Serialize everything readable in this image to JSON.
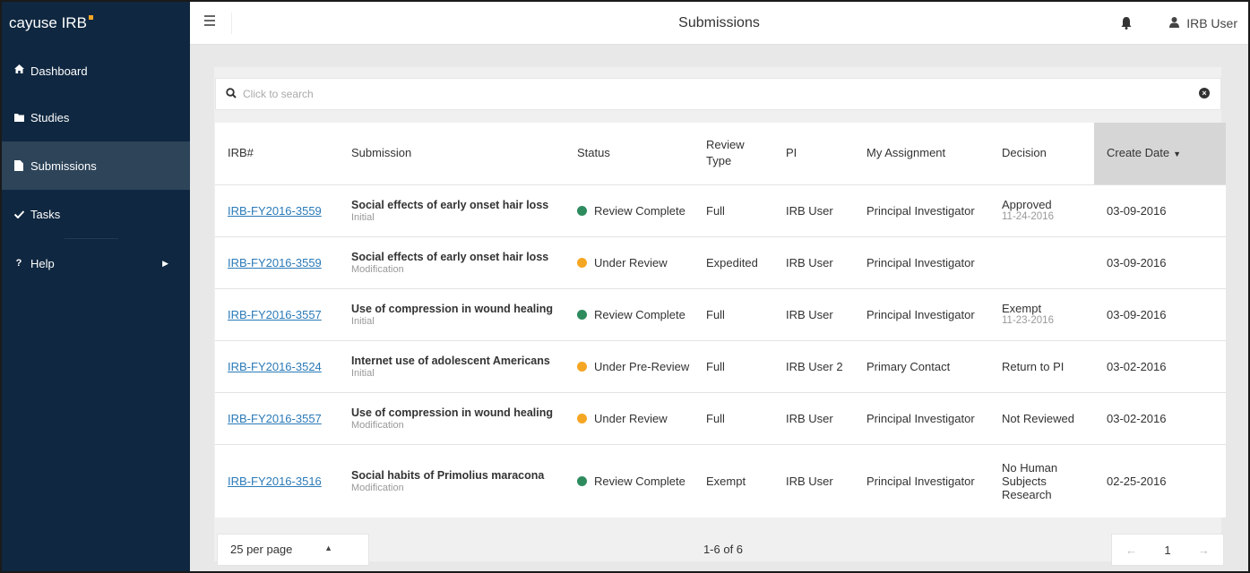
{
  "app": {
    "brand": "cayuse IRB",
    "brand_dot_color": "#f5a623"
  },
  "sidebar": {
    "items": [
      {
        "label": "Dashboard",
        "icon": "home-icon"
      },
      {
        "label": "Studies",
        "icon": "folder-icon"
      },
      {
        "label": "Submissions",
        "icon": "file-icon",
        "active": true
      },
      {
        "label": "Tasks",
        "icon": "check-icon"
      },
      {
        "label": "Help",
        "icon": "question-icon"
      }
    ]
  },
  "topbar": {
    "title": "Submissions",
    "user_label": "IRB User"
  },
  "search": {
    "placeholder": "Click to search"
  },
  "table": {
    "headers": {
      "irb": "IRB#",
      "submission": "Submission",
      "status": "Status",
      "review_type_1": "Review",
      "review_type_2": "Type",
      "pi": "PI",
      "assignment": "My Assignment",
      "decision": "Decision",
      "create_date": "Create Date"
    },
    "rows": [
      {
        "irb": "IRB-FY2016-3559",
        "title": "Social effects of early onset hair loss",
        "kind": "Initial",
        "status": "Review Complete",
        "status_color": "#2e8b5e",
        "review_type": "Full",
        "pi": "IRB User",
        "assignment": "Principal Investigator",
        "decision": "Approved",
        "decision_date": "11-24-2016",
        "create_date": "03-09-2016"
      },
      {
        "irb": "IRB-FY2016-3559",
        "title": "Social effects of early onset hair loss",
        "kind": "Modification",
        "status": "Under Review",
        "status_color": "#f5a623",
        "review_type": "Expedited",
        "pi": "IRB User",
        "assignment": "Principal Investigator",
        "decision": "",
        "decision_date": "",
        "create_date": "03-09-2016"
      },
      {
        "irb": "IRB-FY2016-3557",
        "title": "Use of compression in wound healing",
        "kind": "Initial",
        "status": "Review Complete",
        "status_color": "#2e8b5e",
        "review_type": "Full",
        "pi": "IRB User",
        "assignment": "Principal Investigator",
        "decision": "Exempt",
        "decision_date": "11-23-2016",
        "create_date": "03-09-2016"
      },
      {
        "irb": "IRB-FY2016-3524",
        "title": "Internet use of adolescent Americans",
        "kind": "Initial",
        "status": "Under Pre-Review",
        "status_color": "#f5a623",
        "review_type": "Full",
        "pi": "IRB User 2",
        "assignment": "Primary Contact",
        "decision": "Return to PI",
        "decision_date": "",
        "create_date": "03-02-2016"
      },
      {
        "irb": "IRB-FY2016-3557",
        "title": "Use of compression in wound healing",
        "kind": "Modification",
        "status": "Under Review",
        "status_color": "#f5a623",
        "review_type": "Full",
        "pi": "IRB User",
        "assignment": "Principal Investigator",
        "decision": "Not Reviewed",
        "decision_date": "",
        "create_date": "03-02-2016"
      },
      {
        "irb": "IRB-FY2016-3516",
        "title": "Social habits of Primolius maracona",
        "kind": "Modification",
        "status": "Review Complete",
        "status_color": "#2e8b5e",
        "review_type": "Exempt",
        "pi": "IRB User",
        "assignment": "Principal Investigator",
        "decision_lines": [
          "No Human",
          "Subjects",
          "Research"
        ],
        "decision_date": "",
        "create_date": "02-25-2016"
      }
    ]
  },
  "footer": {
    "per_page": "25 per page",
    "count": "1-6 of 6",
    "page": "1"
  }
}
